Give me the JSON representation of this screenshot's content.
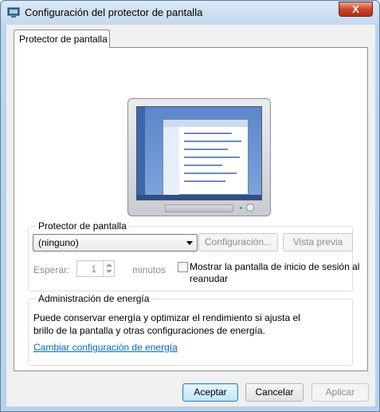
{
  "window": {
    "title": "Configuración del protector de pantalla",
    "close_label": "X"
  },
  "tab": {
    "label": "Protector de pantalla"
  },
  "screensaver": {
    "group_label": "Protector de pantalla",
    "selected": "(ninguno)",
    "settings_button": "Configuración...",
    "preview_button": "Vista previa",
    "wait_label": "Esperar:",
    "wait_value": "1",
    "minutes_label": "minutos",
    "resume_checkbox_label": "Mostrar la pantalla de inicio de sesión al reanudar",
    "resume_checked": false
  },
  "power": {
    "group_label": "Administración de energía",
    "description": "Puede conservar energía y optimizar el rendimiento si ajusta el brillo de la pantalla y otras configuraciones de energía.",
    "link": "Cambiar configuración de energía"
  },
  "footer": {
    "ok": "Aceptar",
    "cancel": "Cancelar",
    "apply": "Aplicar"
  },
  "colors": {
    "link": "#0066cc",
    "close_button": "#c9462c"
  }
}
